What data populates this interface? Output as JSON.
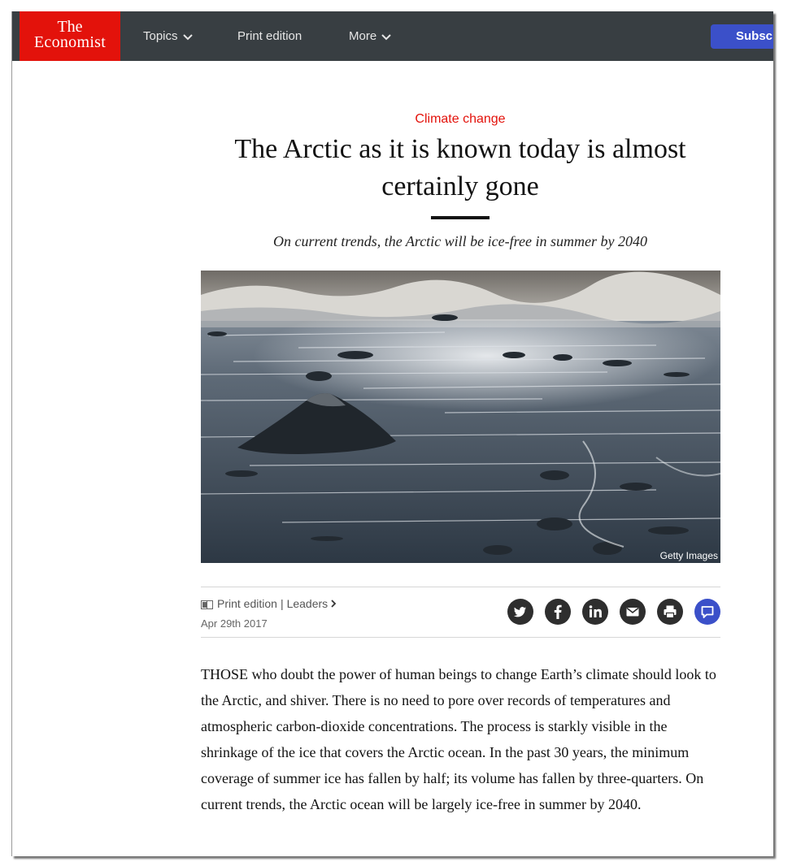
{
  "nav": {
    "logo_line1": "The",
    "logo_line2": "Economist",
    "topics": "Topics",
    "print_edition": "Print edition",
    "more": "More",
    "subscribe": "Subscri"
  },
  "article": {
    "kicker": "Climate change",
    "headline": "The Arctic as it is known today is almost certainly gone",
    "dek": "On current trends, the Arctic will be ice-free in summer by 2040",
    "image_credit": "Getty Images",
    "section_print": "Print edition",
    "section_separator": "|",
    "section_leaders": "Leaders",
    "date": "Apr 29th 2017",
    "body": "THOSE who doubt the power of human beings to change Earth’s climate should look to the Arctic, and shiver. There is no need to pore over records of temperatures and atmospheric carbon-dioxide concentrations. The process is starkly visible in the shrinkage of the ice that covers the Arctic ocean. In the past 30 years, the minimum coverage of summer ice has fallen by half; its volume has fallen by three-quarters. On current trends, the Arctic ocean will be largely ice-free in summer by 2040."
  },
  "share_icons": [
    "twitter-icon",
    "facebook-icon",
    "linkedin-icon",
    "email-icon",
    "print-icon",
    "comment-icon"
  ],
  "colors": {
    "brand_red": "#e3120b",
    "nav_bg": "#383e42",
    "subscribe_blue": "#3b50c9"
  }
}
